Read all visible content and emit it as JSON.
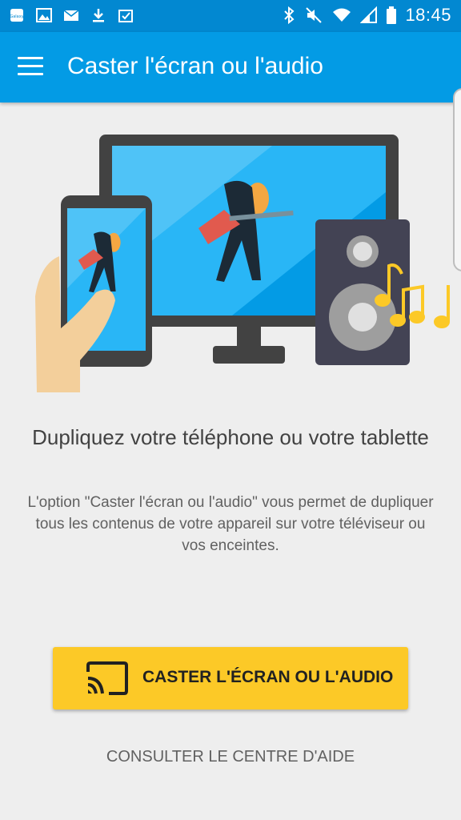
{
  "status_bar": {
    "time": "18:45",
    "notification_icons": [
      "galaxy-apps-icon",
      "image-icon",
      "email-icon",
      "download-icon",
      "task-check-icon"
    ],
    "system_icons": [
      "bluetooth-icon",
      "mute-icon",
      "wifi-icon",
      "signal-icon",
      "battery-icon"
    ]
  },
  "app_bar": {
    "title": "Caster l'écran ou l'audio",
    "menu_icon": "menu-icon"
  },
  "main": {
    "headline": "Dupliquez votre téléphone ou votre tablette",
    "description": "L'option \"Caster l'écran ou l'audio\" vous permet de dupliquer tous les contenus de votre appareil sur votre téléviseur ou vos enceintes.",
    "cast_button_label": "CASTER L'ÉCRAN OU L'AUDIO",
    "cast_button_icon": "cast-icon",
    "help_link": "CONSULTER LE CENTRE D'AIDE"
  },
  "colors": {
    "status_bar": "#0288d1",
    "app_bar": "#039be5",
    "button": "#fcc927",
    "background": "#eeeeee"
  }
}
